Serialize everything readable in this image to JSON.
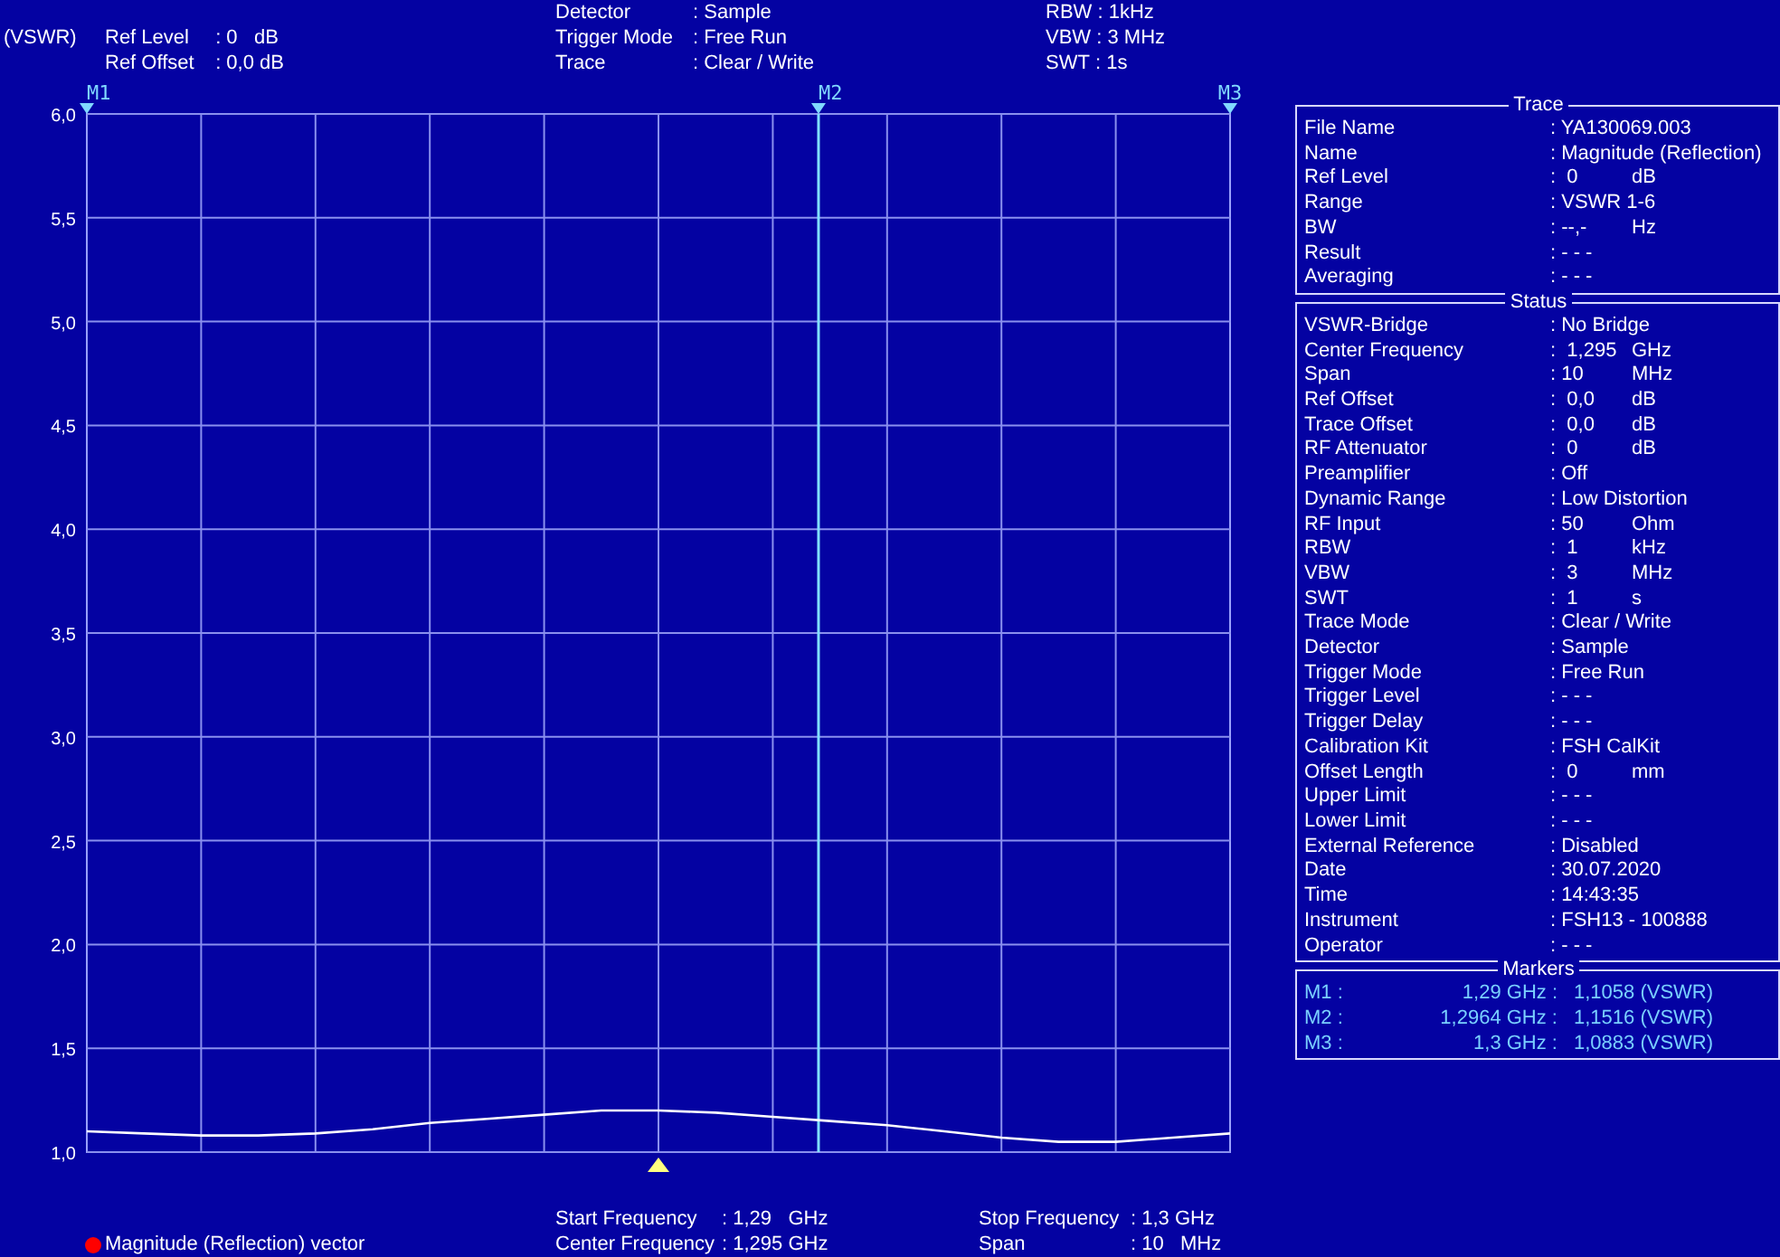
{
  "header": {
    "unit": "(VSWR)",
    "left": [
      {
        "label": "Ref Level",
        "value": ": 0   dB"
      },
      {
        "label": "Ref Offset",
        "value": ": 0,0 dB"
      }
    ],
    "middle": [
      {
        "label": "Detector",
        "value": ": Sample"
      },
      {
        "label": "Trigger Mode",
        "value": ": Free Run"
      },
      {
        "label": "Trace",
        "value": ": Clear / Write"
      }
    ],
    "right": [
      {
        "label": "RBW",
        "value": ": 1kHz"
      },
      {
        "label": "VBW",
        "value": ": 3 MHz"
      },
      {
        "label": "SWT",
        "value": ": 1s"
      }
    ]
  },
  "chart": {
    "markers": [
      {
        "label": "M1"
      },
      {
        "label": "M2"
      },
      {
        "label": "M3"
      }
    ],
    "chart_data": {
      "type": "line",
      "grid": true,
      "ylim": [
        1,
        6
      ],
      "yticks": [
        {
          "value": 1,
          "label": "1,0"
        },
        {
          "value": 1.5,
          "label": "1,5"
        },
        {
          "value": 2,
          "label": "2,0"
        },
        {
          "value": 2.5,
          "label": "2,5"
        },
        {
          "value": 3,
          "label": "3,0"
        },
        {
          "value": 3.5,
          "label": "3,5"
        },
        {
          "value": 4,
          "label": "4,0"
        },
        {
          "value": 4.5,
          "label": "4,5"
        },
        {
          "value": 5,
          "label": "5,0"
        },
        {
          "value": 5.5,
          "label": "5,5"
        },
        {
          "value": 6,
          "label": "6,0"
        }
      ],
      "categories": [
        null,
        null,
        null,
        null,
        null,
        null,
        null,
        null,
        null,
        null,
        null,
        null,
        null,
        null,
        null,
        null,
        null,
        null,
        null,
        null,
        null
      ],
      "series": [
        {
          "color": "#ffffff",
          "values": [
            1.1,
            1.09,
            1.08,
            1.08,
            1.09,
            1.11,
            1.14,
            1.16,
            1.18,
            1.2,
            1.2,
            1.19,
            1.17,
            1.15,
            1.13,
            1.1,
            1.07,
            1.05,
            1.05,
            1.07,
            1.09
          ]
        }
      ]
    }
  },
  "trace": {
    "title": "Trace",
    "rows": [
      {
        "label": "File Name",
        "value": ": YA130069.003"
      },
      {
        "label": "Name",
        "value": ": Magnitude (Reflection)"
      },
      {
        "label": "Ref Level",
        "value": ":  0",
        "unit": "dB"
      },
      {
        "label": "Range",
        "value": ": VSWR 1-6"
      },
      {
        "label": "BW",
        "value": ": --,-",
        "unit": "Hz"
      },
      {
        "label": "Result",
        "value": ": - - -"
      },
      {
        "label": "Averaging",
        "value": ": - - -"
      }
    ]
  },
  "status": {
    "title": "Status",
    "rows": [
      {
        "label": "VSWR-Bridge",
        "value": ": No Bridge"
      },
      {
        "label": "Center Frequency",
        "value": ":  1,295",
        "unit": "GHz"
      },
      {
        "label": "Span",
        "value": ": 10",
        "unit": "MHz"
      },
      {
        "label": "Ref Offset",
        "value": ":  0,0",
        "unit": "dB"
      },
      {
        "label": "Trace Offset",
        "value": ":  0,0",
        "unit": "dB"
      },
      {
        "label": "RF Attenuator",
        "value": ":  0",
        "unit": "dB"
      },
      {
        "label": "Preamplifier",
        "value": ": Off"
      },
      {
        "label": "Dynamic Range",
        "value": ": Low Distortion"
      },
      {
        "label": "RF Input",
        "value": ": 50",
        "unit": "Ohm"
      },
      {
        "label": "RBW",
        "value": ":  1",
        "unit": "kHz"
      },
      {
        "label": "VBW",
        "value": ":  3",
        "unit": "MHz"
      },
      {
        "label": "SWT",
        "value": ":  1",
        "unit": "s"
      },
      {
        "label": "Trace Mode",
        "value": ": Clear / Write"
      },
      {
        "label": "Detector",
        "value": ": Sample"
      },
      {
        "label": "Trigger Mode",
        "value": ": Free Run"
      },
      {
        "label": "Trigger Level",
        "value": ": - - -"
      },
      {
        "label": "Trigger Delay",
        "value": ": - - -"
      },
      {
        "label": "Calibration Kit",
        "value": ": FSH CalKit"
      },
      {
        "label": "Offset Length",
        "value": ":  0",
        "unit": "mm"
      },
      {
        "label": "Upper Limit",
        "value": ": - - -"
      },
      {
        "label": "Lower Limit",
        "value": ": - - -"
      },
      {
        "label": "External Reference",
        "value": ": Disabled"
      },
      {
        "label": "Date",
        "value": ": 30.07.2020"
      },
      {
        "label": "Time",
        "value": ": 14:43:35"
      },
      {
        "label": "Instrument",
        "value": ": FSH13 - 100888"
      },
      {
        "label": "Operator",
        "value": ": - - -"
      }
    ]
  },
  "markers": {
    "title": "Markers",
    "rows": [
      {
        "name": "M1 :",
        "frequency": "1,29 GHz :",
        "value": "1,1058 (VSWR)"
      },
      {
        "name": "M2 :",
        "frequency": "1,2964 GHz :",
        "value": "1,1516 (VSWR)"
      },
      {
        "name": "M3 :",
        "frequency": "1,3 GHz :",
        "value": "1,0883 (VSWR)"
      }
    ]
  },
  "footer": {
    "legend": {
      "label": "Magnitude (Reflection) vector",
      "color": "#ff0000"
    },
    "left": [
      {
        "label": "Start Frequency",
        "value": ": 1,29   GHz"
      },
      {
        "label": "Center Frequency",
        "value": ": 1,295 GHz"
      }
    ],
    "right": [
      {
        "label": "Stop Frequency",
        "value": ": 1,3 GHz"
      },
      {
        "label": "Span",
        "value": ": 10   MHz"
      }
    ]
  }
}
